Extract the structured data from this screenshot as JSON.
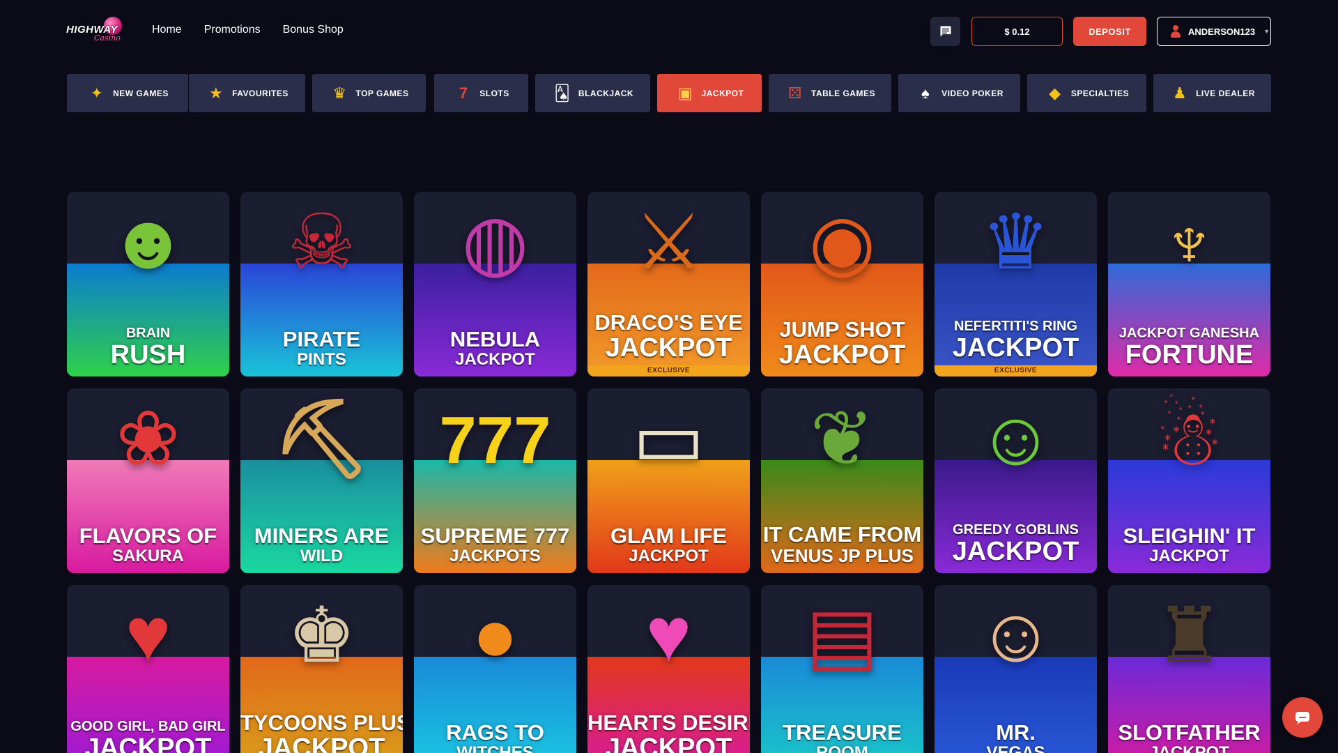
{
  "header": {
    "logo_text": "HIGHWAY",
    "logo_sub": "Casino",
    "nav": [
      "Home",
      "Promotions",
      "Bonus Shop"
    ],
    "balance": "$ 0.12",
    "deposit_label": "DEPOSIT",
    "username": "ANDERSON123",
    "chat_icon": "message-icon"
  },
  "categories": [
    {
      "label": "NEW GAMES",
      "icon": "new-games-icon",
      "active": false
    },
    {
      "label": "FAVOURITES",
      "icon": "star-icon",
      "active": false
    },
    {
      "label": "TOP GAMES",
      "icon": "crown-icon",
      "active": false
    },
    {
      "label": "SLOTS",
      "icon": "slots-777-icon",
      "active": false
    },
    {
      "label": "BLACKJACK",
      "icon": "cards-icon",
      "active": false
    },
    {
      "label": "JACKPOT",
      "icon": "slot-machine-icon",
      "active": true
    },
    {
      "label": "TABLE GAMES",
      "icon": "dice-icon",
      "active": false
    },
    {
      "label": "VIDEO POKER",
      "icon": "poker-cards-icon",
      "active": false
    },
    {
      "label": "SPECIALTIES",
      "icon": "gems-icon",
      "active": false
    },
    {
      "label": "LIVE DEALER",
      "icon": "dealer-icon",
      "active": false
    }
  ],
  "games": [
    {
      "line1": "BRAIN",
      "line2": "RUSH",
      "art": "zombie-icon",
      "colors": [
        "#0c7bd0",
        "#2fd14a"
      ],
      "badge": ""
    },
    {
      "line1": "PIRATE",
      "line2": "PINTS",
      "art": "pirate-icon",
      "colors": [
        "#2a45d8",
        "#19c4d8"
      ],
      "badge": ""
    },
    {
      "line1": "NEBULA",
      "line2": "JACKPOT",
      "art": "planet-icon",
      "colors": [
        "#3b1fa0",
        "#8a2ad8"
      ],
      "badge": ""
    },
    {
      "line1": "DRACO'S EYE",
      "line2": "JACKPOT",
      "art": "dragon-icon",
      "colors": [
        "#e36a1a",
        "#f29a2a"
      ],
      "badge": "EXCLUSIVE"
    },
    {
      "line1": "JUMP SHOT",
      "line2": "JACKPOT",
      "art": "basketball-icon",
      "colors": [
        "#e2581a",
        "#f08a1a"
      ],
      "badge": ""
    },
    {
      "line1": "NEFERTITI'S RING",
      "line2": "JACKPOT",
      "art": "queen-icon",
      "colors": [
        "#1e3aa8",
        "#3b55c8"
      ],
      "badge": "EXCLUSIVE"
    },
    {
      "line1": "JACKPOT GANESHA",
      "line2": "FORTUNE",
      "art": "elephant-icon",
      "colors": [
        "#2f6ad8",
        "#e02aa8"
      ],
      "badge": ""
    },
    {
      "line1": "FLAVORS OF",
      "line2": "SAKURA",
      "art": "geisha-icon",
      "colors": [
        "#f07ab8",
        "#d81aa0"
      ],
      "badge": ""
    },
    {
      "line1": "MINERS ARE",
      "line2": "WILD",
      "art": "miner-icon",
      "colors": [
        "#1a8fa0",
        "#1ad8a0"
      ],
      "badge": ""
    },
    {
      "line1": "SUPREME 777",
      "line2": "JACKPOTS",
      "art": "seven-icon",
      "colors": [
        "#1ab8a8",
        "#f07a1a"
      ],
      "badge": ""
    },
    {
      "line1": "GLAM LIFE",
      "line2": "JACKPOT",
      "art": "car-icon",
      "colors": [
        "#f0a01a",
        "#e2381a"
      ],
      "badge": ""
    },
    {
      "line1": "IT CAME FROM",
      "line2": "VENUS JP PLUS",
      "art": "plant-icon",
      "colors": [
        "#3a8a1a",
        "#e2681a"
      ],
      "badge": ""
    },
    {
      "line1": "GREEDY GOBLINS",
      "line2": "JACKPOT",
      "art": "goblin-icon",
      "colors": [
        "#3a1a8a",
        "#8a2ad8"
      ],
      "badge": ""
    },
    {
      "line1": "SLEIGHIN' IT",
      "line2": "JACKPOT",
      "art": "santa-icon",
      "colors": [
        "#2a3ad8",
        "#8a2ad8"
      ],
      "badge": ""
    },
    {
      "line1": "GOOD GIRL, BAD GIRL",
      "line2": "JACKPOT",
      "art": "angel-devil-icon",
      "colors": [
        "#d81aa0",
        "#9a1ad8"
      ],
      "badge": ""
    },
    {
      "line1": "TYCOONS PLUS",
      "line2": "JACKPOT",
      "art": "tycoon-icon",
      "colors": [
        "#e2681a",
        "#d8a01a"
      ],
      "badge": ""
    },
    {
      "line1": "RAGS TO",
      "line2": "WITCHES",
      "art": "pumpkin-icon",
      "colors": [
        "#1a8ad8",
        "#1ac8e2"
      ],
      "badge": ""
    },
    {
      "line1": "HEARTS DESIRE",
      "line2": "JACKPOT",
      "art": "heart-icon",
      "colors": [
        "#e2381a",
        "#d81aa0"
      ],
      "badge": ""
    },
    {
      "line1": "TREASURE",
      "line2": "ROOM",
      "art": "chest-icon",
      "colors": [
        "#1a8ad8",
        "#1ac8c8"
      ],
      "badge": ""
    },
    {
      "line1": "MR.",
      "line2": "VEGAS",
      "art": "man-icon",
      "colors": [
        "#1a3ab8",
        "#2a5ad8"
      ],
      "badge": ""
    },
    {
      "line1": "SLOTFATHER",
      "line2": "JACKPOT",
      "art": "godfather-icon",
      "colors": [
        "#6a2ad8",
        "#d81aa0"
      ],
      "badge": ""
    }
  ],
  "chat_fab_icon": "chat-bubble-icon"
}
